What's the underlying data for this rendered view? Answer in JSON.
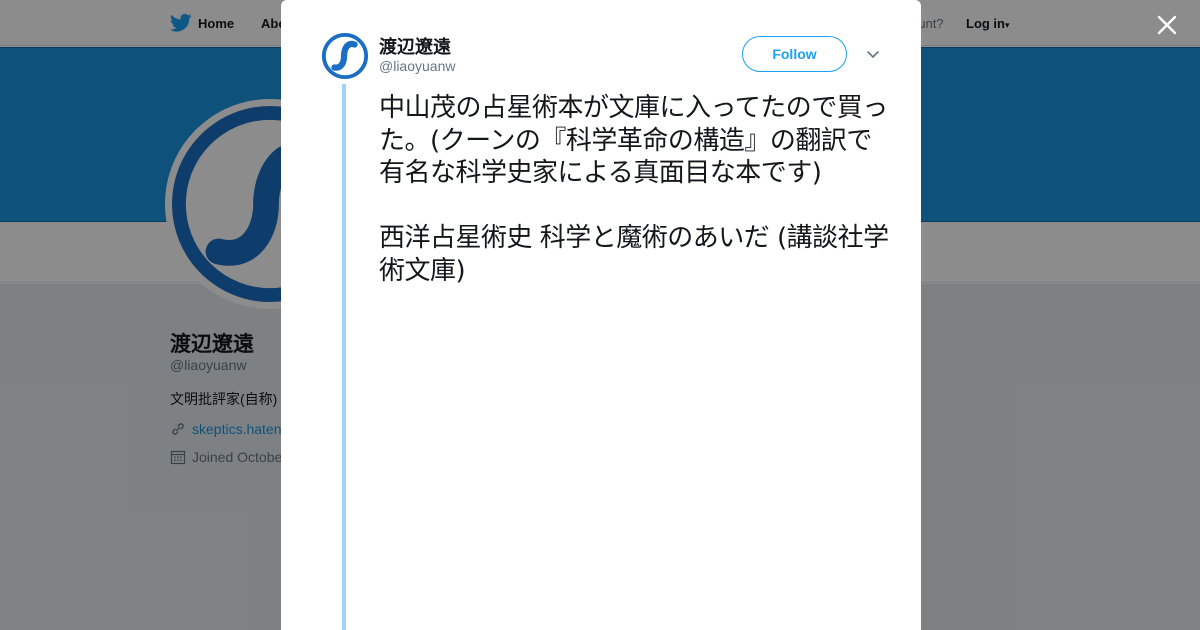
{
  "nav": {
    "home_label": "Home",
    "about_label": "Abo",
    "account_prompt": "ccount?",
    "login_label": "Log in"
  },
  "profile": {
    "name": "渡辺遼遠",
    "handle": "@liaoyuanw",
    "bio": "文明批評家(自称)",
    "link": "skeptics.haten",
    "joined": "Joined Octobe"
  },
  "tweet": {
    "author_name": "渡辺遼遠",
    "author_handle": "@liaoyuanw",
    "follow_label": "Follow",
    "text": "中山茂の占星術本が文庫に入ってたので買った。(クーンの『科学革命の構造』の翻訳で有名な科学史家による真面目な本です)\n\n西洋占星術史 科学と魔術のあいだ (講談社学術文庫)"
  },
  "colors": {
    "brand_blue": "#1da1f2",
    "banner_blue": "#1b95e0",
    "avatar_blue": "#1a6fc4",
    "thread_line": "#a3d4f7"
  },
  "icons": {
    "nav_logo": "twitter-bird-icon",
    "close": "close-icon",
    "caret": "chevron-down-icon",
    "link": "link-icon",
    "calendar": "calendar-icon"
  }
}
